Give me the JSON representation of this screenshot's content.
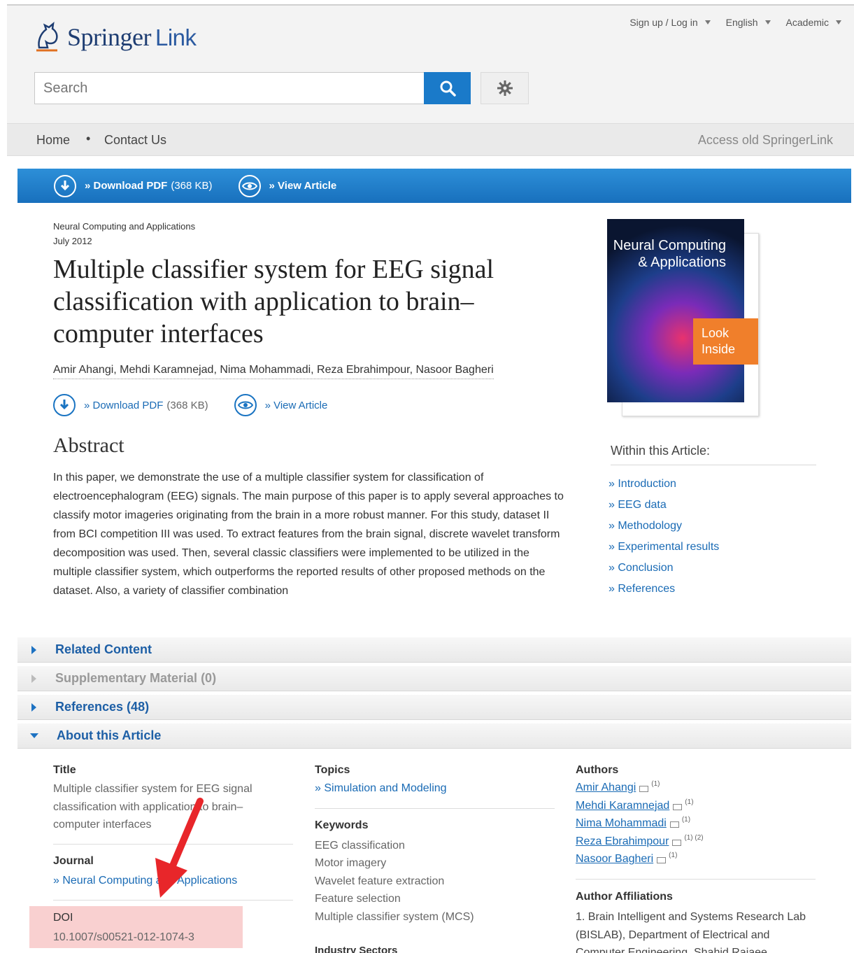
{
  "header": {
    "brand": "Springer",
    "brand_suffix": "Link",
    "signup": "Sign up / Log in",
    "language": "English",
    "segment": "Academic",
    "search_placeholder": "Search"
  },
  "nav": {
    "home": "Home",
    "separator": "•",
    "contact": "Contact Us",
    "old_link": "Access old SpringerLink"
  },
  "actions": {
    "download_pdf": "» Download PDF",
    "download_size": "(368 KB)",
    "view_article": "» View Article"
  },
  "article": {
    "journal": "Neural Computing and Applications",
    "date": "July 2012",
    "title": "Multiple classifier system for EEG signal classification with application to brain–computer interfaces",
    "authors": "Amir Ahangi, Mehdi Karamnejad, Nima Mohammadi, Reza Ebrahimpour, Nasoor Bagheri",
    "abstract_heading": "Abstract",
    "abstract": "In this paper, we demonstrate the use of a multiple classifier system for classification of electroencephalogram (EEG) signals. The main purpose of this paper is to apply several approaches to classify motor imageries originating from the brain in a more robust manner. For this study, dataset II from BCI competition III was used. To extract features from the brain signal, discrete wavelet transform decomposition was used. Then, several classic classifiers were implemented to be utilized in the multiple classifier system, which outperforms the reported results of other proposed methods on the dataset. Also, a variety of classifier combination"
  },
  "cover": {
    "title_line1": "Neural Computing",
    "title_line2": "& Applications",
    "look_inside_line1": "Look",
    "look_inside_line2": "Inside"
  },
  "within": {
    "heading": "Within this Article:",
    "items": [
      "Introduction",
      "EEG data",
      "Methodology",
      "Experimental results",
      "Conclusion",
      "References"
    ]
  },
  "accordions": {
    "related": "Related Content",
    "supplementary": "Supplementary Material (0)",
    "references": "References (48)",
    "about": "About this Article"
  },
  "about": {
    "title_label": "Title",
    "title_value": "Multiple classifier system for EEG signal classification with application to brain–computer interfaces",
    "journal_label": "Journal",
    "journal_value": "» Neural Computing and Applications",
    "doi_label": "DOI",
    "doi_value": "10.1007/s00521-012-1074-3",
    "topics_label": "Topics",
    "topics_value": "» Simulation and Modeling",
    "keywords_label": "Keywords",
    "keywords": [
      "EEG classification",
      "Motor imagery",
      "Wavelet feature extraction",
      "Feature selection",
      "Multiple classifier system (MCS)"
    ],
    "industry_label": "Industry Sectors",
    "authors_label": "Authors",
    "authors": [
      {
        "name": "Amir Ahangi",
        "sup": "(1)"
      },
      {
        "name": "Mehdi Karamnejad",
        "sup": "(1)"
      },
      {
        "name": "Nima Mohammadi",
        "sup": "(1)"
      },
      {
        "name": "Reza Ebrahimpour",
        "sup": "(1) (2)"
      },
      {
        "name": "Nasoor Bagheri",
        "sup": "(1)"
      }
    ],
    "affiliations_label": "Author Affiliations",
    "affiliation_1": "1. Brain Intelligent and Systems Research Lab (BISLAB), Department of Electrical and Computer Engineering, Shahid Rajaee"
  },
  "colors": {
    "accent": "#1a7ac9",
    "link": "#1a6bb5",
    "look_inside": "#f07f2b",
    "doi_highlight": "#f9d0d0",
    "annotation_arrow": "#e8262a"
  },
  "icons": {
    "logo": "springer-horse-icon",
    "search": "search-icon",
    "settings": "gear-icon",
    "download": "download-icon",
    "view": "eye-icon",
    "email": "envelope-icon",
    "annotation": "red-arrow-icon"
  }
}
